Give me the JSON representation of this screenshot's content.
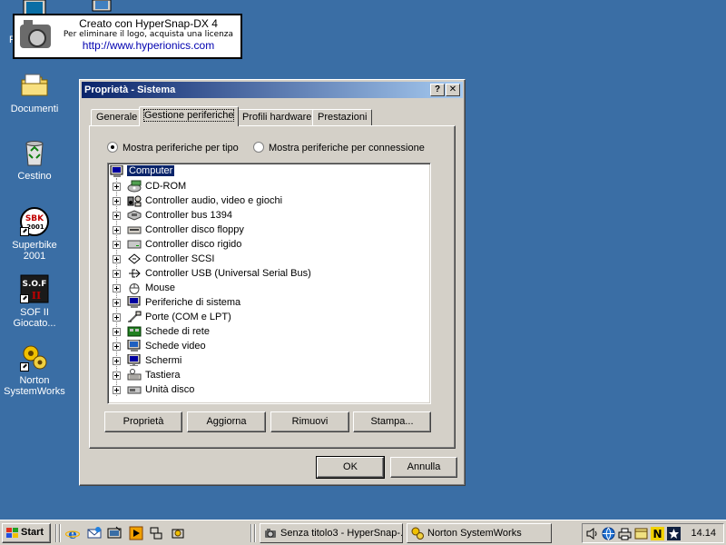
{
  "watermark": {
    "line1": "Creato con HyperSnap-DX 4",
    "line2": "Per eliminare il logo, acquista una licenza",
    "line3": "http://www.hyperionics.com"
  },
  "desktop": {
    "icons": [
      {
        "label": "Documenti",
        "icon": "folder-icon"
      },
      {
        "label": "Cestino",
        "icon": "recycle-bin-icon"
      },
      {
        "label": "Superbike 2001",
        "icon": "superbike-icon",
        "badge": "SBK 2001"
      },
      {
        "label": "SOF II Giocato...",
        "icon": "sof-icon",
        "badge": "S.O.F II"
      },
      {
        "label": "Norton SystemWorks",
        "icon": "norton-icon"
      }
    ],
    "partial_label": "R"
  },
  "dialog": {
    "title": "Proprietà - Sistema",
    "help_label": "?",
    "close_label": "✕",
    "tabs": [
      "Generale",
      "Gestione periferiche",
      "Profili hardware",
      "Prestazioni"
    ],
    "active_tab": "Gestione periferiche",
    "radio_by_type": "Mostra periferiche per tipo",
    "radio_by_connection": "Mostra periferiche per connessione",
    "selected_view": "Mostra periferiche per tipo",
    "tree_root": "Computer",
    "devices": [
      "CD-ROM",
      "Controller audio, video e giochi",
      "Controller bus 1394",
      "Controller disco floppy",
      "Controller disco rigido",
      "Controller SCSI",
      "Controller USB (Universal Serial Bus)",
      "Mouse",
      "Periferiche di sistema",
      "Porte (COM e LPT)",
      "Schede di rete",
      "Schede video",
      "Schermi",
      "Tastiera",
      "Unità disco"
    ],
    "buttons": {
      "properties": "Proprietà",
      "refresh": "Aggiorna",
      "remove": "Rimuovi",
      "print": "Stampa..."
    },
    "ok": "OK",
    "cancel": "Annulla"
  },
  "taskbar": {
    "start": "Start",
    "tasks": [
      "Senza titolo3 - HyperSnap-...",
      "Norton SystemWorks"
    ],
    "clock": "14.14"
  },
  "colors": {
    "desktop": "#3a6ea5",
    "titlebar_start": "#0a246a",
    "titlebar_end": "#a6caf0",
    "face": "#d4d0c8",
    "link": "#0000b0"
  }
}
